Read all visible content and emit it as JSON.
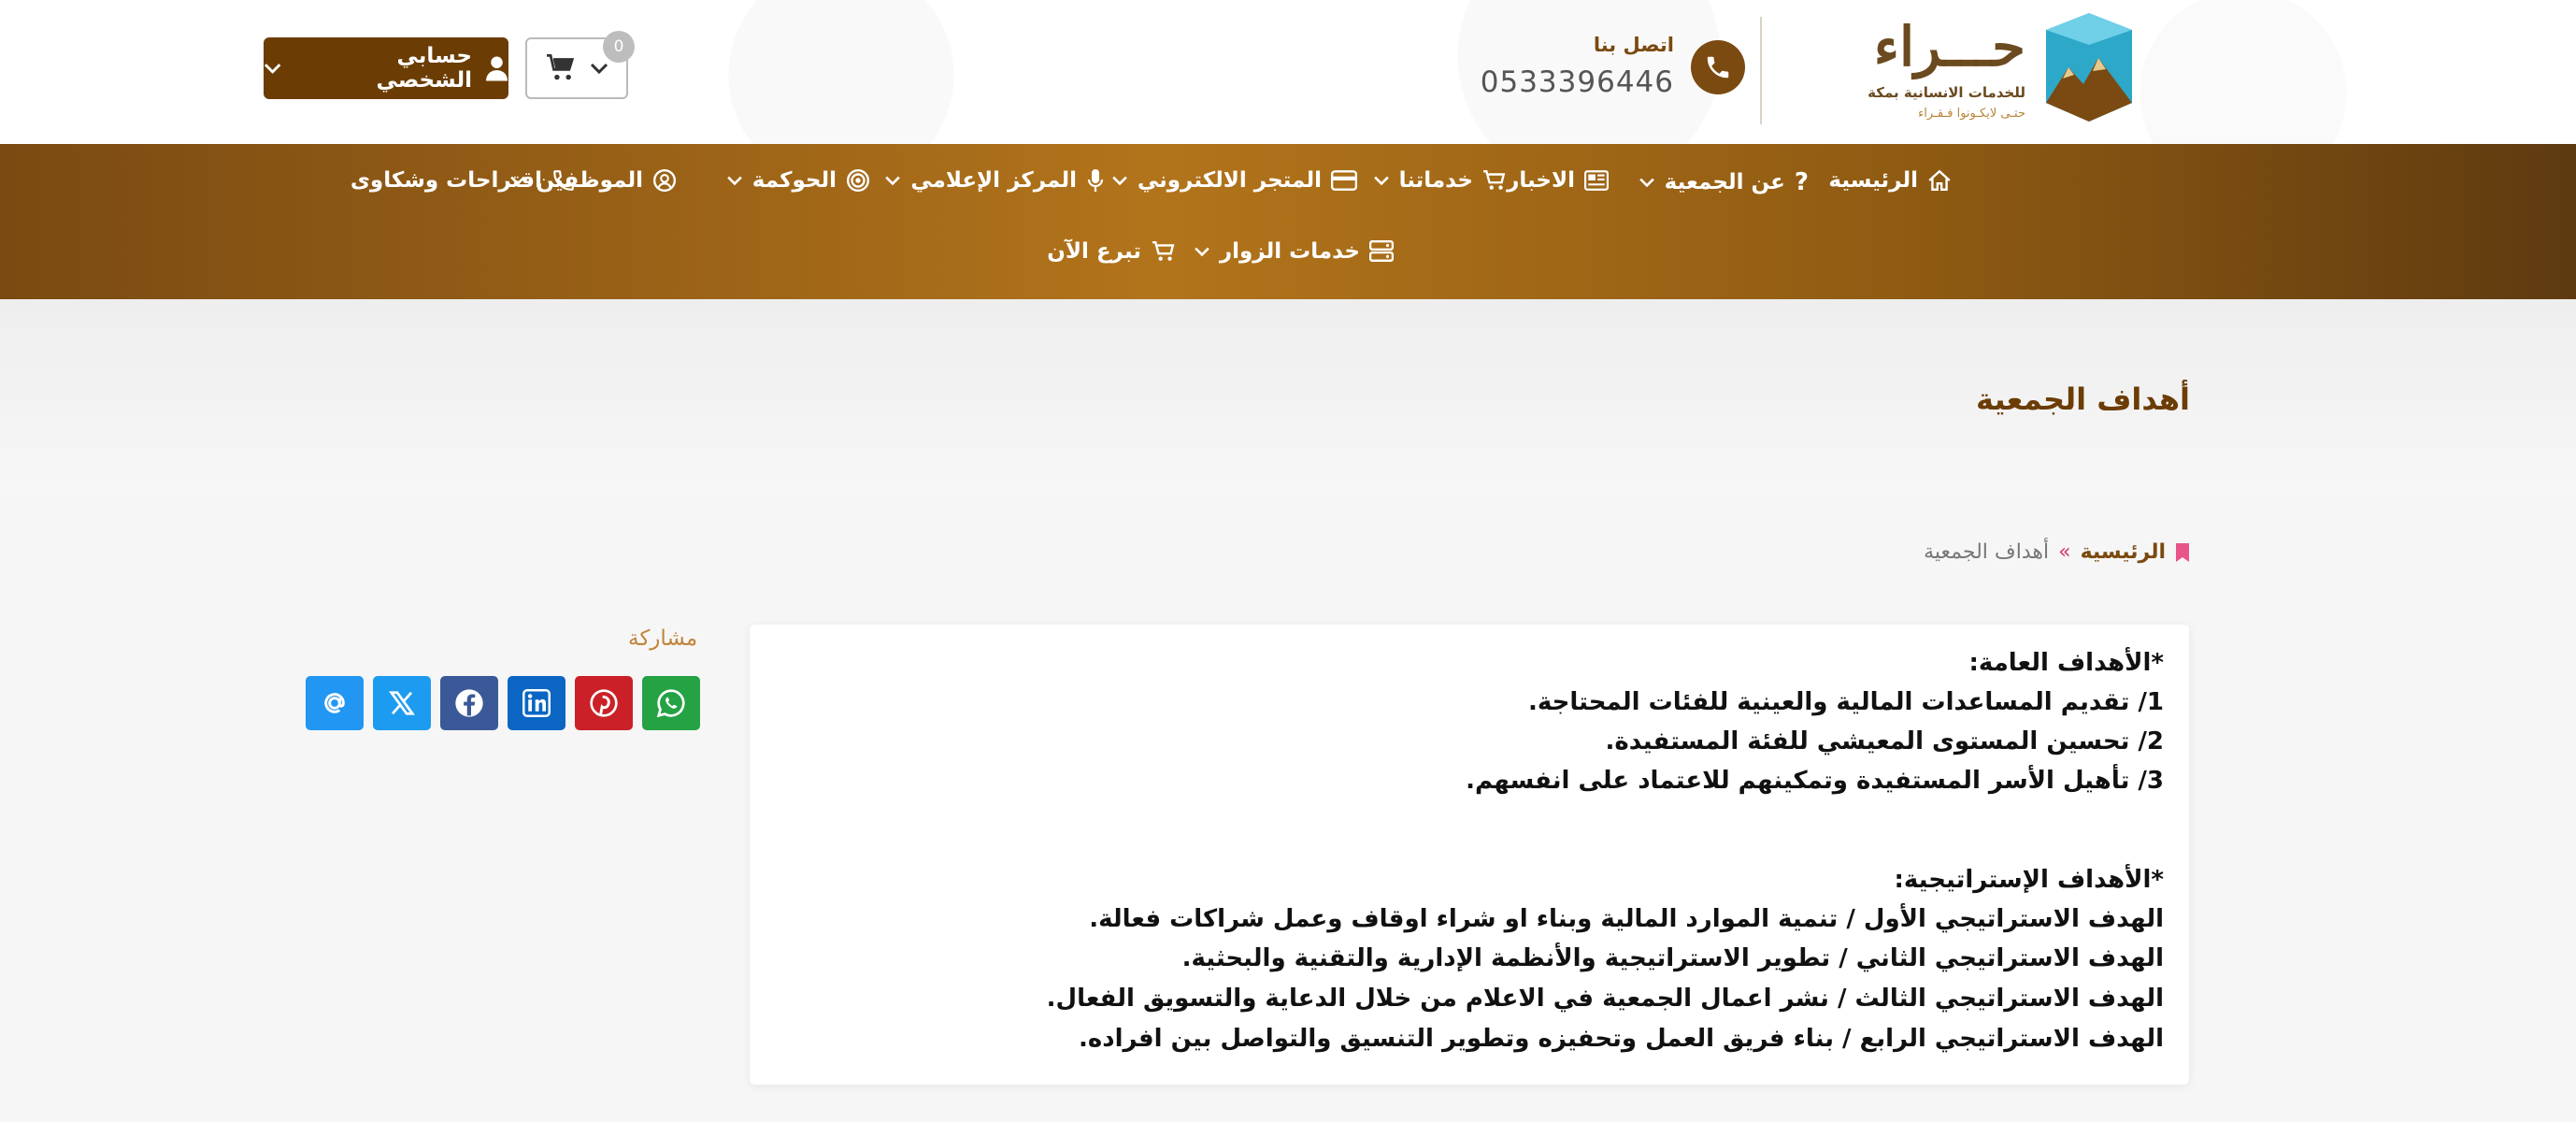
{
  "header": {
    "logo_title": "حـــراء",
    "logo_subtitle": "للخدمات الانسانية بمكة",
    "logo_tagline": "حتـى لايكـونوا فـقـراء",
    "contact_label": "اتصل بنا",
    "contact_number": "0533396446",
    "cart_count": "0",
    "account_label": "حسابي الشخصي"
  },
  "nav": {
    "home": "الرئيسية",
    "about": "عن الجمعية",
    "news": "الاخبار",
    "services": "خدماتنا",
    "store": "المتجر الالكتروني",
    "media": "المركز الإعلامي",
    "governance": "الحوكمة",
    "employees": "الموظفين",
    "suggestions": "اقتراحات وشكاوى",
    "visitors": "خدمات الزوار",
    "donate": "تبرع الآن"
  },
  "page": {
    "title": "أهداف الجمعية",
    "breadcrumb_home": "الرئيسية",
    "breadcrumb_sep": "»",
    "breadcrumb_current": "أهداف الجمعية"
  },
  "content": {
    "general_heading": "*الأهداف العامة:",
    "general": [
      "1/ تقديم المساعدات المالية والعينية للفئات المحتاجة.",
      "2/ تحسين المستوى المعيشي للفئة المستفيدة.",
      "3/ تأهيل الأسر المستفيدة وتمكينهم للاعتماد على انفسهم."
    ],
    "strategic_heading": "*الأهداف الإستراتيجية:",
    "strategic": [
      "الهدف الاستراتيجي الأول / تنمية الموارد المالية وبناء او شراء اوقاف وعمل شراكات فعالة.",
      "الهدف الاستراتيجي الثاني / تطوير الاستراتيجية والأنظمة الإدارية والتقنية والبحثية.",
      "الهدف الاستراتيجي الثالث / نشر اعمال الجمعية في الاعلام من خلال الدعاية والتسويق الفعال.",
      "الهدف الاستراتيجي الرابع / بناء فريق العمل وتحفيزه وتطوير التنسيق والتواصل بين افراده."
    ]
  },
  "share": {
    "label": "مشاركة"
  },
  "colors": {
    "brand_brown": "#6b3d05",
    "nav_gold": "#b2741b",
    "share_email": "#2196f3",
    "share_x": "#1d9bf0",
    "share_facebook": "#3b5998",
    "share_linkedin": "#0a66c2",
    "share_pinterest": "#cb2027",
    "share_whatsapp": "#25a244"
  }
}
